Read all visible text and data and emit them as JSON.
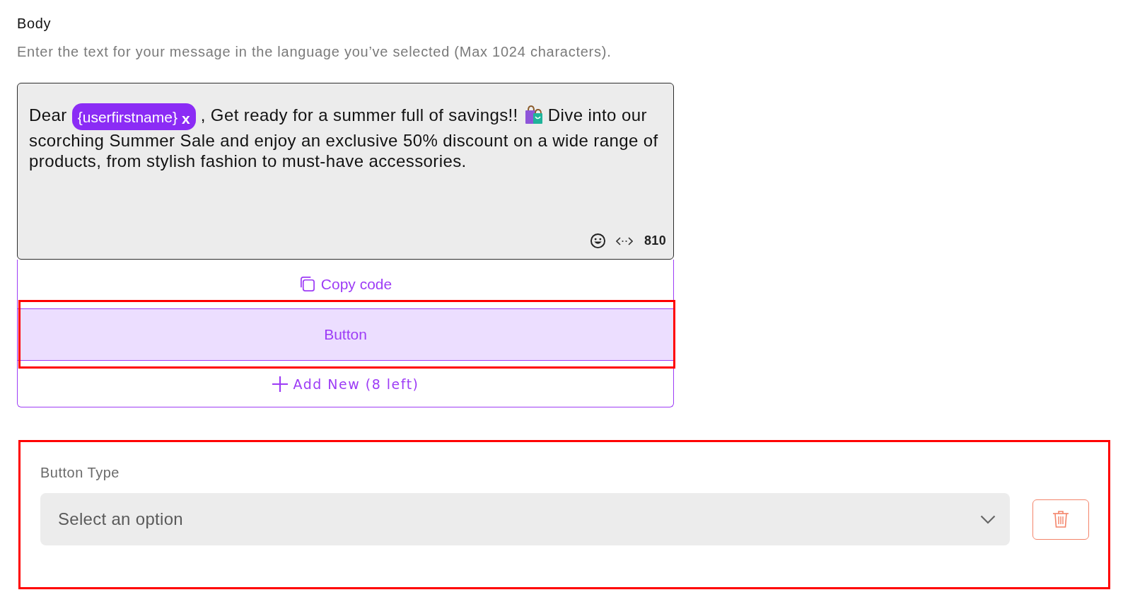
{
  "body_section": {
    "title": "Body",
    "hint": "Enter the text for your message in the language you’ve selected (Max 1024 characters).",
    "editor": {
      "segments": [
        {
          "kind": "text",
          "text": "Dear"
        },
        {
          "kind": "variable",
          "text": "{userfirstname}",
          "remove": "x"
        },
        {
          "kind": "text",
          "text": ", Get ready for a summer full of savings!!"
        },
        {
          "kind": "emoji"
        },
        {
          "kind": "text",
          "text": "Dive into our scorching Summer Sale and enjoy an exclusive 50% discount on a wide range of products, from stylish fashion to must-have accessories."
        }
      ],
      "char_count": "810"
    },
    "buttons": {
      "items": [
        {
          "kind": "copy",
          "label": "Copy code",
          "selected": false,
          "highlighted": false
        },
        {
          "kind": "plain",
          "label": "Button",
          "selected": true,
          "highlighted": true
        }
      ],
      "add_new": "Add New (8 left)"
    }
  },
  "button_type": {
    "label": "Button Type",
    "highlighted": true,
    "select": {
      "placeholder": "Select an option"
    }
  }
}
